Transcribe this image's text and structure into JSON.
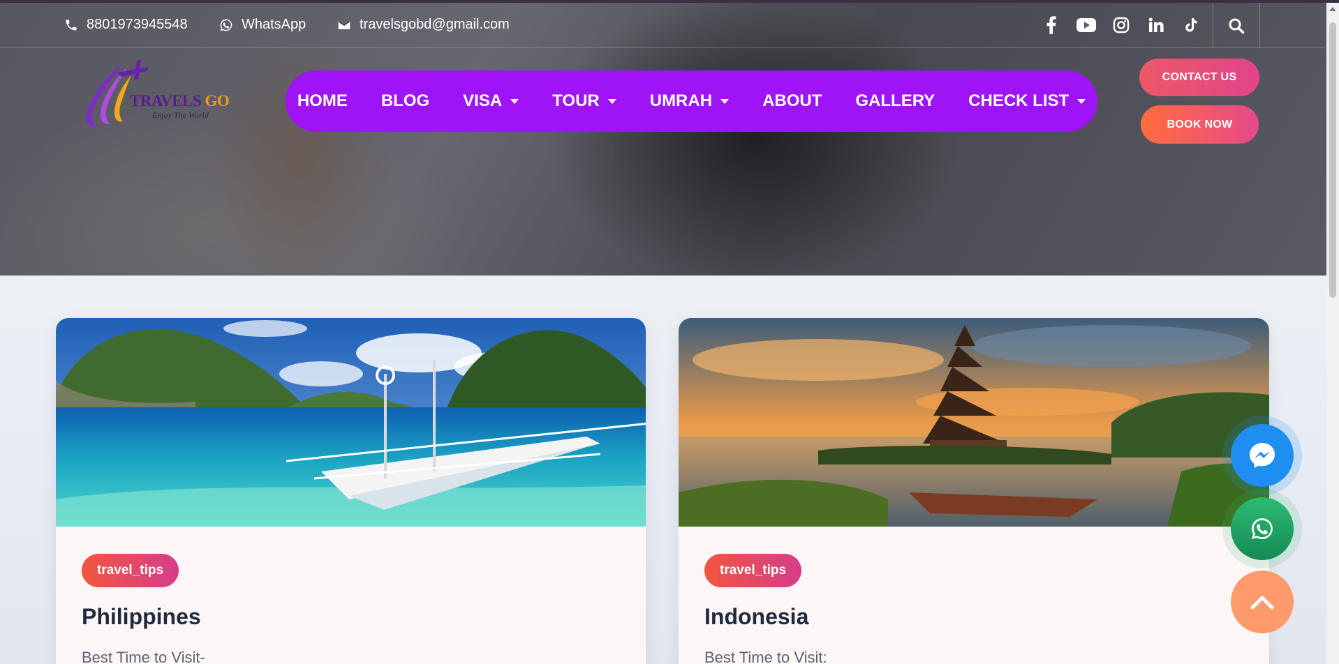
{
  "topbar": {
    "phone": "8801973945548",
    "whatsapp": "WhatsApp",
    "email": "travelsgobd@gmail.com",
    "social_icons": [
      "facebook-icon",
      "youtube-icon",
      "instagram-icon",
      "linkedin-icon",
      "tiktok-icon"
    ]
  },
  "logo": {
    "brand_main": "TRAVELS",
    "brand_accent": "GO",
    "tagline": "Enjoy The World"
  },
  "nav": {
    "items": [
      {
        "label": "HOME",
        "dropdown": false
      },
      {
        "label": "BLOG",
        "dropdown": false
      },
      {
        "label": "VISA",
        "dropdown": true
      },
      {
        "label": "TOUR",
        "dropdown": true
      },
      {
        "label": "UMRAH",
        "dropdown": true
      },
      {
        "label": "ABOUT",
        "dropdown": false
      },
      {
        "label": "GALLERY",
        "dropdown": false
      },
      {
        "label": "CHECK LIST",
        "dropdown": true
      }
    ]
  },
  "buttons": {
    "contact": "CONTACT US",
    "book": "BOOK NOW"
  },
  "cards": [
    {
      "tag": "travel_tips",
      "title": "Philippines",
      "text": "Best Time to Visit-"
    },
    {
      "tag": "travel_tips",
      "title": "Indonesia",
      "text": "Best Time to Visit:"
    }
  ],
  "colors": {
    "nav_bg": "#9e14f7",
    "contact_btn": "#ec5868",
    "book_btn": "#ff6d3c",
    "tag_bg": "#f1563f",
    "messenger": "#1f8ef1",
    "whatsapp": "#2dbb74",
    "scroll_top": "#ff9a6b"
  }
}
